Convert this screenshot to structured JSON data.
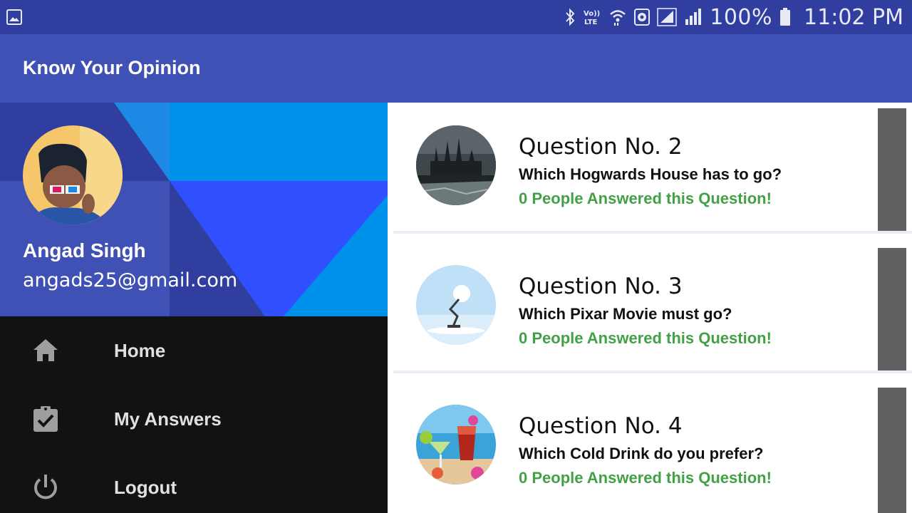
{
  "status_bar": {
    "battery_text": "100%",
    "time": "11:02 PM",
    "icons": [
      "gallery-notification-icon",
      "bluetooth-icon",
      "volte-icon",
      "wifi-icon",
      "data-saver-icon",
      "signal-sim1-icon",
      "signal-sim2-icon",
      "battery-icon"
    ],
    "colors": {
      "background": "#303f9f"
    }
  },
  "app_bar": {
    "title": "Know Your Opinion",
    "colors": {
      "background": "#3f51b5"
    }
  },
  "drawer": {
    "user": {
      "name": "Angad Singh",
      "email": "angads25@gmail.com"
    },
    "items": [
      {
        "label": "Home",
        "icon": "home-icon"
      },
      {
        "label": "My Answers",
        "icon": "assignment-check-icon"
      },
      {
        "label": "Logout",
        "icon": "power-icon"
      }
    ],
    "colors": {
      "background": "#121212",
      "header": "#0091ea"
    }
  },
  "questions": [
    {
      "title": "Question No. 2",
      "text": "Which Hogwards House has to go?",
      "answers": "0 People Answered this Question!",
      "image": "hogwarts-castle-image"
    },
    {
      "title": "Question No. 3",
      "text": "Which Pixar Movie must go?",
      "answers": "0 People Answered this Question!",
      "image": "pixar-lamp-image"
    },
    {
      "title": "Question No. 4",
      "text": "Which Cold Drink do you prefer?",
      "answers": "0 People Answered this Question!",
      "image": "cold-drinks-image"
    }
  ],
  "colors": {
    "answer_count": "#43a047",
    "card_handle": "#616161"
  }
}
